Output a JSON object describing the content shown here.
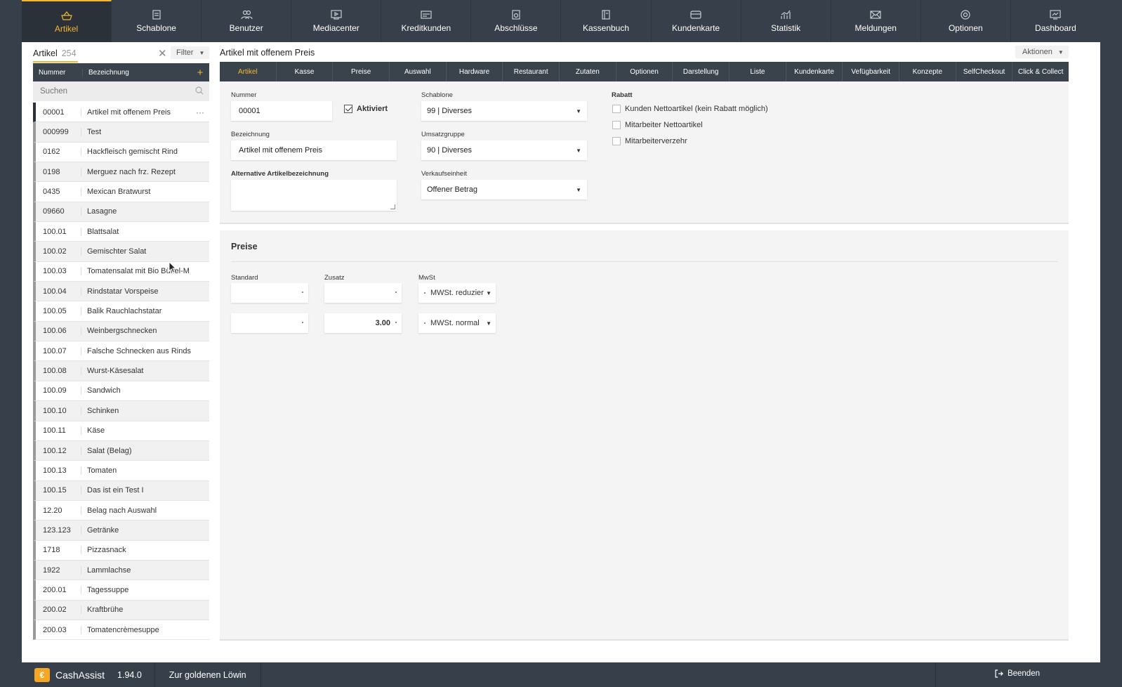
{
  "topnav": [
    {
      "label": "Artikel",
      "icon": "basket-icon",
      "active": true
    },
    {
      "label": "Schablone",
      "icon": "template-icon",
      "active": false
    },
    {
      "label": "Benutzer",
      "icon": "users-icon",
      "active": false
    },
    {
      "label": "Mediacenter",
      "icon": "media-icon",
      "active": false
    },
    {
      "label": "Kreditkunden",
      "icon": "credit-card-icon",
      "active": false
    },
    {
      "label": "Abschlüsse",
      "icon": "report-icon",
      "active": false
    },
    {
      "label": "Kassenbuch",
      "icon": "book-icon",
      "active": false
    },
    {
      "label": "Kundenkarte",
      "icon": "card-icon",
      "active": false
    },
    {
      "label": "Statistik",
      "icon": "chart-icon",
      "active": false
    },
    {
      "label": "Meldungen",
      "icon": "mail-icon",
      "active": false
    },
    {
      "label": "Optionen",
      "icon": "gear-icon",
      "active": false
    },
    {
      "label": "Dashboard",
      "icon": "dashboard-icon",
      "active": false
    }
  ],
  "left": {
    "title": "Artikel",
    "count": "254",
    "filter": "Filter",
    "col_num": "Nummer",
    "col_name": "Bezeichnung",
    "search_placeholder": "Suchen",
    "items": [
      {
        "num": "00001",
        "name": "Artikel mit offenem Preis",
        "selected": true
      },
      {
        "num": "000999",
        "name": "Test"
      },
      {
        "num": "0162",
        "name": "Hackfleisch gemischt Rind"
      },
      {
        "num": "0198",
        "name": "Merguez nach frz. Rezept"
      },
      {
        "num": "0435",
        "name": "Mexican Bratwurst"
      },
      {
        "num": "09660",
        "name": "Lasagne"
      },
      {
        "num": "100.01",
        "name": "Blattsalat"
      },
      {
        "num": "100.02",
        "name": "Gemischter Salat"
      },
      {
        "num": "100.03",
        "name": "Tomatensalat mit Bio Büffel-M"
      },
      {
        "num": "100.04",
        "name": "Rindstatar Vorspeise"
      },
      {
        "num": "100.05",
        "name": "Balik Rauchlachstatar"
      },
      {
        "num": "100.06",
        "name": "Weinbergschnecken"
      },
      {
        "num": "100.07",
        "name": "Falsche Schnecken aus Rinds"
      },
      {
        "num": "100.08",
        "name": "Wurst-Käsesalat"
      },
      {
        "num": "100.09",
        "name": "Sandwich"
      },
      {
        "num": "100.10",
        "name": "Schinken"
      },
      {
        "num": "100.11",
        "name": "Käse"
      },
      {
        "num": "100.12",
        "name": "Salat (Belag)"
      },
      {
        "num": "100.13",
        "name": "Tomaten"
      },
      {
        "num": "100.15",
        "name": "Das ist ein Test I"
      },
      {
        "num": "12.20",
        "name": "Belag nach Auswahl"
      },
      {
        "num": "123.123",
        "name": "Getränke"
      },
      {
        "num": "1718",
        "name": "Pizzasnack"
      },
      {
        "num": "1922",
        "name": "Lammlachse"
      },
      {
        "num": "200.01",
        "name": "Tagessuppe"
      },
      {
        "num": "200.02",
        "name": "Kraftbrühe"
      },
      {
        "num": "200.03",
        "name": "Tomatencrèmesuppe"
      }
    ]
  },
  "right": {
    "title": "Artikel mit offenem Preis",
    "actions": "Aktionen",
    "tabs": [
      "Artikel",
      "Kasse",
      "Preise",
      "Auswahl",
      "Hardware",
      "Restaurant",
      "Zutaten",
      "Optionen",
      "Darstellung",
      "Liste",
      "Kundenkarte",
      "Vefügbarkeit",
      "Konzepte",
      "SelfCheckout",
      "Click & Collect"
    ],
    "form": {
      "nummer_label": "Nummer",
      "nummer_value": "00001",
      "aktiviert_label": "Aktiviert",
      "bezeichnung_label": "Bezeichnung",
      "bezeichnung_value": "Artikel mit offenem Preis",
      "alt_label": "Alternative Artikelbezeichnung",
      "alt_value": "",
      "schablone_label": "Schablone",
      "schablone_value": "99 | Diverses",
      "umsatz_label": "Umsatzgruppe",
      "umsatz_value": "90 | Diverses",
      "vk_label": "Verkaufseinheit",
      "vk_value": "Offener Betrag",
      "rabatt_label": "Rabatt",
      "rabatt_options": [
        "Kunden Nettoartikel (kein Rabatt möglich)",
        "Mitarbeiter Nettoartikel",
        "Mitarbeiterverzehr"
      ]
    },
    "prices": {
      "title": "Preise",
      "standard_label": "Standard",
      "zusatz_label": "Zusatz",
      "mwst_label": "MwSt",
      "rows": [
        {
          "standard": "",
          "zusatz": "",
          "mwst": "MWSt. reduziert"
        },
        {
          "standard": "",
          "zusatz": "3.00",
          "mwst": "MWSt. normal"
        }
      ]
    }
  },
  "footer": {
    "brand": "CashAssist",
    "version": "1.94.0",
    "location": "Zur goldenen Löwin",
    "logout": "Beenden"
  },
  "colors": {
    "accent": "#f5b731",
    "dark": "#37404a"
  }
}
